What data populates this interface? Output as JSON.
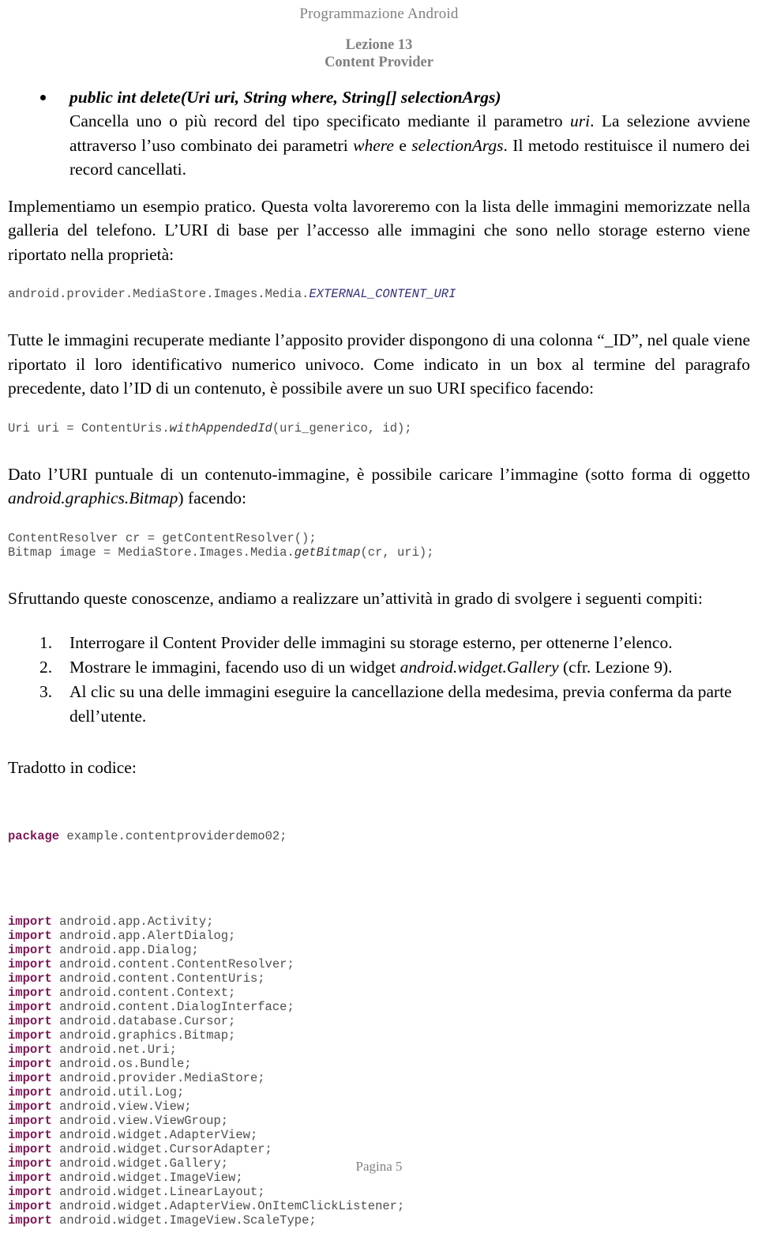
{
  "header": {
    "doc_title": "Programmazione Android",
    "lesson": "Lezione 13",
    "subject": "Content Provider",
    "color": "#808080"
  },
  "bullet_section": {
    "signature": "public int delete(Uri uri, String where, String[] selectionArgs)",
    "desc_part1": "Cancella uno o più record del tipo specificato mediante il parametro ",
    "desc_italic1": "uri",
    "desc_part2": ". La selezione avviene attraverso l’uso combinato dei parametri ",
    "desc_italic2": "where",
    "desc_part3": " e ",
    "desc_italic3": "selectionArgs",
    "desc_part4": ". Il metodo restituisce il numero dei record cancellati."
  },
  "paragraphs": {
    "p1": "Implementiamo un esempio pratico. Questa volta lavoreremo con la lista delle immagini memorizzate nella galleria del telefono. L’URI di base per l’accesso alle immagini che sono nello storage esterno viene riportato nella proprietà:",
    "p2": "Tutte le immagini recuperate mediante l’apposito provider dispongono di una colonna “_ID”, nel quale viene riportato il loro identificativo numerico univoco. Come indicato in un box al termine del paragrafo precedente, dato l’ID di un contenuto, è possibile avere un suo URI specifico facendo:",
    "p3_a": "Dato l’URI puntuale di un contenuto-immagine, è possibile caricare l’immagine (sotto forma di oggetto ",
    "p3_italic": "android.graphics.Bitmap",
    "p3_b": ") facendo:",
    "p4": "Sfruttando queste conoscenze, andiamo a realizzare un’attività in grado di svolgere i seguenti compiti:",
    "p5": "Tradotto in codice:"
  },
  "code_uri_constant": {
    "plain": "android.provider.MediaStore.Images.Media.",
    "italic_blue": "EXTERNAL_CONTENT_URI"
  },
  "code_appended_id": {
    "pre": "Uri uri = ContentUris.",
    "italic": "withAppendedId",
    "post": "(uri_generico, id);"
  },
  "code_bitmap": {
    "line1": "ContentResolver cr = getContentResolver();",
    "line2_pre": "Bitmap image = MediaStore.Images.Media.",
    "line2_italic": "getBitmap",
    "line2_post": "(cr, uri);"
  },
  "tasks": [
    {
      "marker": "1.",
      "text_a": "Interrogare il Content Provider delle immagini su storage esterno, per ottenerne l’elenco.",
      "italic": "",
      "text_b": ""
    },
    {
      "marker": "2.",
      "text_a": "Mostrare le immagini, facendo uso di un widget ",
      "italic": "android.widget.Gallery",
      "text_b": " (cfr. Lezione 9)."
    },
    {
      "marker": "3.",
      "text_a": "Al clic su una delle immagini eseguire la cancellazione della medesima, previa conferma da parte dell’utente.",
      "italic": "",
      "text_b": ""
    }
  ],
  "source_code": {
    "package_keyword": "package",
    "package_name": " example.contentproviderdemo02;",
    "import_keyword": "import",
    "imports": [
      " android.app.Activity;",
      " android.app.AlertDialog;",
      " android.app.Dialog;",
      " android.content.ContentResolver;",
      " android.content.ContentUris;",
      " android.content.Context;",
      " android.content.DialogInterface;",
      " android.database.Cursor;",
      " android.graphics.Bitmap;",
      " android.net.Uri;",
      " android.os.Bundle;",
      " android.provider.MediaStore;",
      " android.util.Log;",
      " android.view.View;",
      " android.view.ViewGroup;",
      " android.widget.AdapterView;",
      " android.widget.CursorAdapter;",
      " android.widget.Gallery;",
      " android.widget.ImageView;",
      " android.widget.LinearLayout;",
      " android.widget.AdapterView.OnItemClickListener;",
      " android.widget.ImageView.ScaleType;"
    ],
    "keyword_color": "#7B1A56",
    "text_color": "#4d4d4d"
  },
  "footer": {
    "page_label": "Pagina 5"
  }
}
